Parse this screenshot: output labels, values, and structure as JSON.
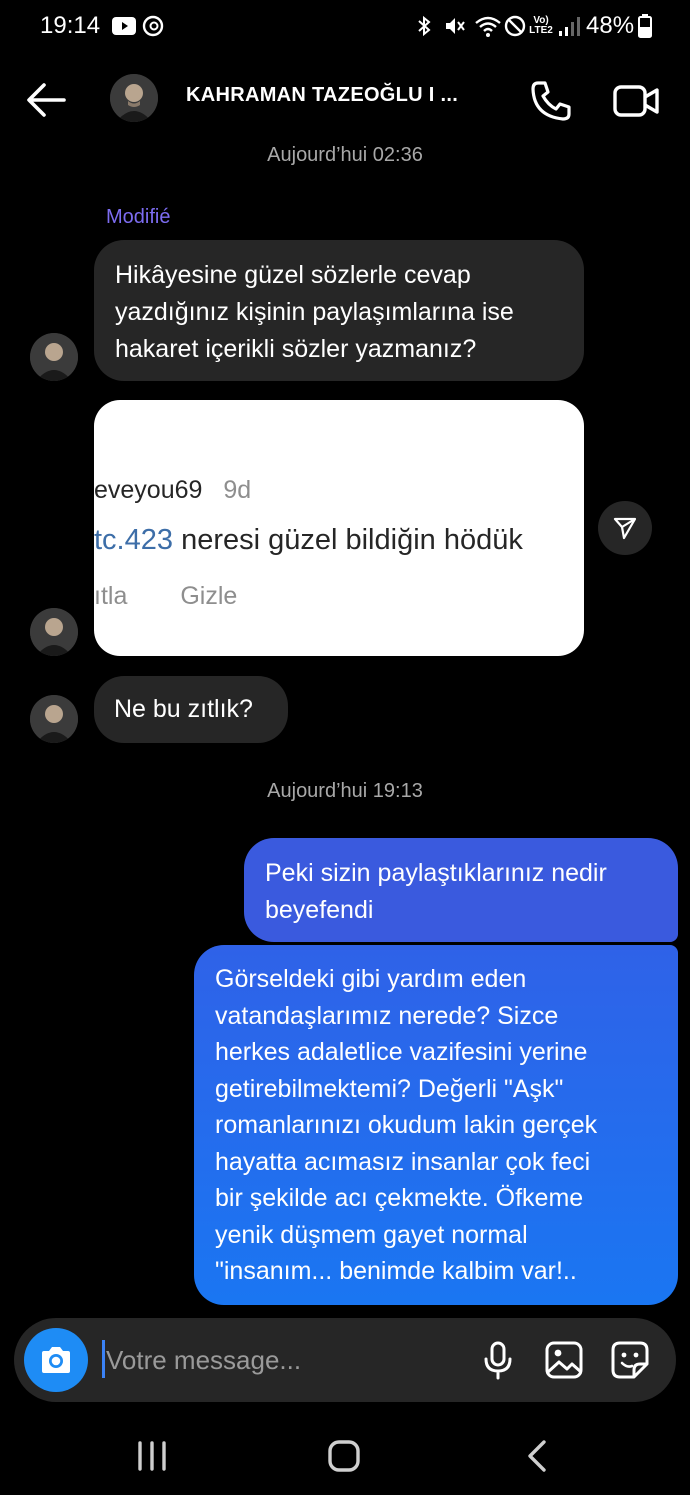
{
  "status_bar": {
    "time": "19:14",
    "battery_percent": "48%",
    "network_label": "Vo) LTE2"
  },
  "header": {
    "contact_name": "KAHRAMAN TAZEOĞLU I ...",
    "icons": [
      "back-arrow-icon",
      "phone-icon",
      "video-camera-icon"
    ]
  },
  "thread": {
    "timestamp_1": "Aujourd’hui 02:36",
    "modified_label": "Modifié",
    "incoming_1_lines": [
      "Hikâyesine güzel sözlerle cevap",
      "yazdığınız kişinin paylaşımlarına ise",
      "hakaret içerikli sözler yazmanız?"
    ],
    "screenshot": {
      "username": "eveyou69",
      "age": "9d",
      "mention": "tc.423",
      "comment": "neresi güzel bildiğin hödük",
      "action_reply": "ıtla",
      "action_hide": "Gizle"
    },
    "incoming_2": "Ne bu zıtlık?",
    "timestamp_2": "Aujourd’hui 19:13",
    "outgoing_1_lines": [
      "Peki sizin paylaştıklarınız nedir",
      "beyefendi"
    ],
    "outgoing_2_lines": [
      "Görseldeki gibi yardım eden",
      "vatandaşlarımız nerede? Sizce",
      "herkes adaletlice vazifesini yerine",
      "getirebilmektemi? Değerli \"Aşk\"",
      "romanlarınızı okudum lakin gerçek",
      "hayatta acımasız insanlar çok feci",
      "bir şekilde acı çekmekte. Öfkeme",
      "yenik düşmem gayet normal",
      "\"insanım... benimde kalbim var!.."
    ]
  },
  "composer": {
    "placeholder": "Votre message...",
    "icons": [
      "camera-icon",
      "microphone-icon",
      "gallery-icon",
      "sticker-icon"
    ]
  },
  "colors": {
    "background": "#000000",
    "incoming_bubble": "#262626",
    "outgoing_top": "#3a5fe0",
    "outgoing_bottom": "#1a73f0",
    "modified": "#7c6cf0",
    "camera_button": "#1e8cf5"
  }
}
